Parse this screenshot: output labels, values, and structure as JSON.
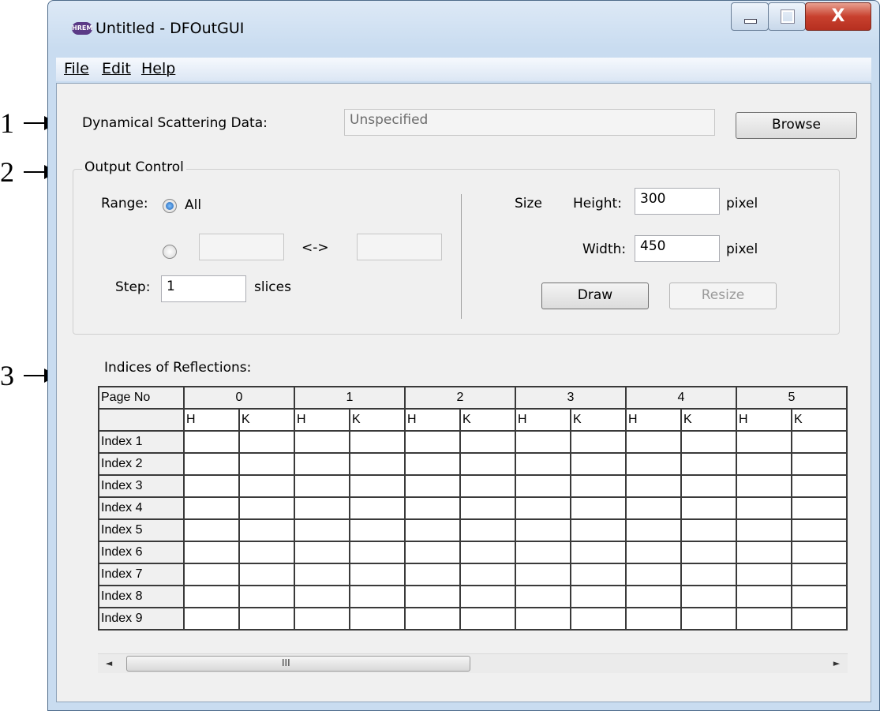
{
  "callouts": [
    "1",
    "2",
    "3"
  ],
  "window": {
    "title": "Untitled - DFOutGUI",
    "icon_text": "HREM",
    "close_glyph": "X"
  },
  "menu": [
    "File",
    "Edit",
    "Help"
  ],
  "data_section": {
    "label": "Dynamical Scattering Data:",
    "path_value": "Unspecified",
    "browse_label": "Browse"
  },
  "output_control": {
    "title": "Output Control",
    "range_label": "Range:",
    "range_all_label": "All",
    "range_from": "",
    "range_sep": "<->",
    "range_to": "",
    "step_label": "Step:",
    "step_value": "1",
    "step_unit": "slices",
    "size_label": "Size",
    "height_label": "Height:",
    "height_value": "300",
    "width_label": "Width:",
    "width_value": "450",
    "pixel_unit": "pixel",
    "draw_label": "Draw",
    "resize_label": "Resize"
  },
  "table": {
    "title": "Indices of Reflections:",
    "corner_label": "Page No",
    "pages": [
      "0",
      "1",
      "2",
      "3",
      "4",
      "5"
    ],
    "subcols": [
      "H",
      "K"
    ],
    "rows": [
      "Index 1",
      "Index 2",
      "Index 3",
      "Index 4",
      "Index 5",
      "Index 6",
      "Index 7",
      "Index 8",
      "Index 9"
    ]
  },
  "scrollbar": {
    "left_arrow": "◄",
    "right_arrow": "►",
    "grip": "III"
  }
}
